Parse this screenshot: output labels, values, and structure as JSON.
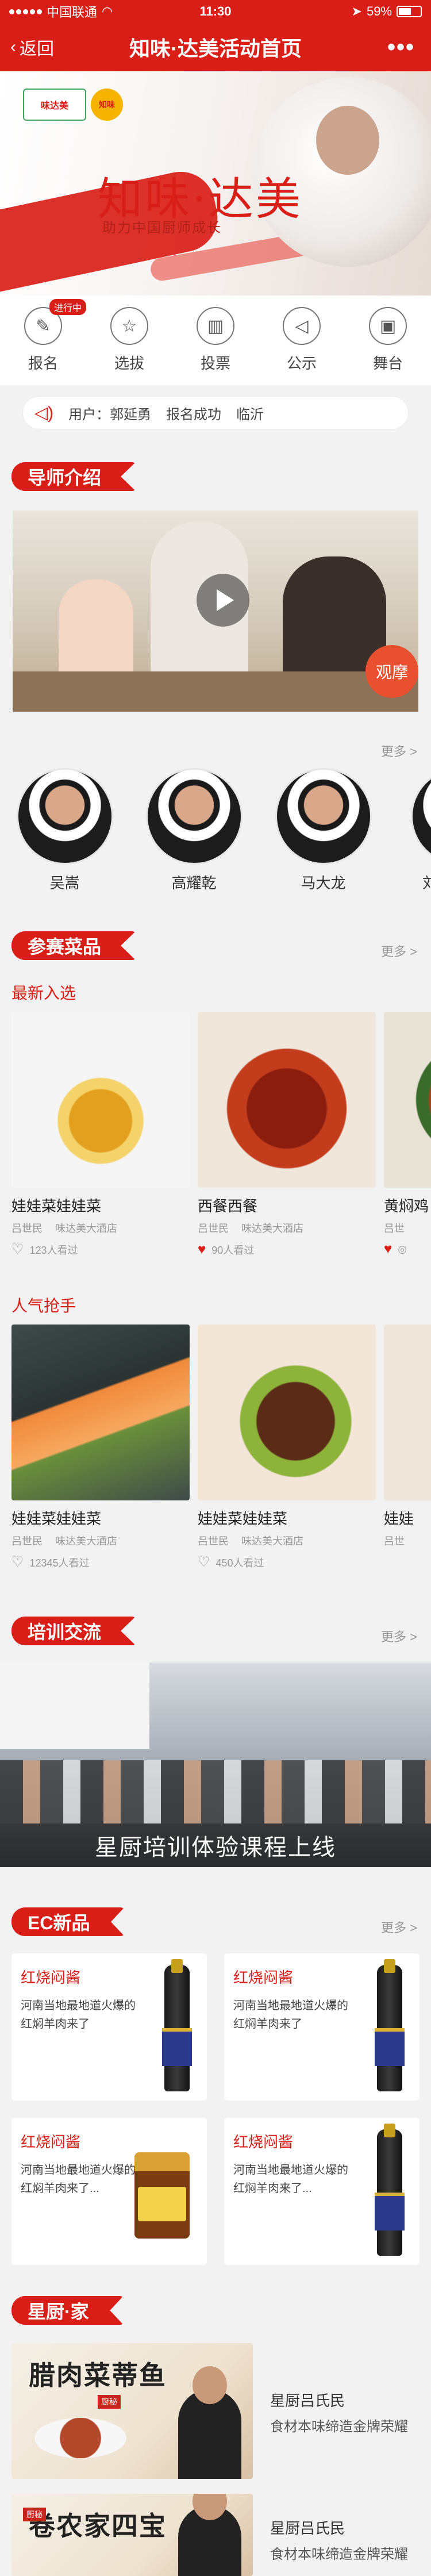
{
  "status_bar": {
    "carrier": "中国联通",
    "time": "11:30",
    "battery": "59%",
    "battery_level": 0.59
  },
  "nav": {
    "back_label": "返回",
    "title": "知味·达美活动首页",
    "more_label": "•••"
  },
  "hero": {
    "brand": "知味·达美",
    "tagline": "助力中国厨师成长",
    "logo_left": "味达美",
    "logo_right": "知味"
  },
  "quick_menu": [
    {
      "label": "报名",
      "icon": "edit-icon",
      "badge": "进行中"
    },
    {
      "label": "选拔",
      "icon": "star-icon"
    },
    {
      "label": "投票",
      "icon": "bar-chart-icon"
    },
    {
      "label": "公示",
      "icon": "megaphone-icon"
    },
    {
      "label": "舞台",
      "icon": "stage-icon"
    }
  ],
  "notice": {
    "user_prefix": "用户：",
    "user_name": "郭延勇",
    "action": "报名成功",
    "city": "临沂"
  },
  "mentor_section": {
    "title": "导师介绍",
    "more": "更多 >",
    "watch_label": "观摩"
  },
  "mentors": [
    {
      "name": "吴嵩"
    },
    {
      "name": "高耀乾"
    },
    {
      "name": "马大龙"
    },
    {
      "name": "刘"
    }
  ],
  "dish_section": {
    "title": "参赛菜品",
    "more": "更多 >"
  },
  "newest": {
    "title": "最新入选",
    "items": [
      {
        "name": "娃娃菜娃娃菜",
        "author": "吕世民",
        "hotel": "味达美大酒店",
        "views": "123人看过",
        "liked": false
      },
      {
        "name": "西餐西餐",
        "author": "吕世民",
        "hotel": "味达美大酒店",
        "views": "90人看过",
        "liked": true
      },
      {
        "name": "黄焖鸡",
        "author": "吕世",
        "hotel": "",
        "views": "",
        "liked": true
      }
    ]
  },
  "popular": {
    "title": "人气抢手",
    "items": [
      {
        "name": "娃娃菜娃娃菜",
        "author": "吕世民",
        "hotel": "味达美大酒店",
        "views": "12345人看过",
        "liked": false
      },
      {
        "name": "娃娃菜娃娃菜",
        "author": "吕世民",
        "hotel": "味达美大酒店",
        "views": "450人看过",
        "liked": false
      },
      {
        "name": "娃娃",
        "author": "吕世",
        "hotel": "",
        "views": "",
        "liked": false
      }
    ]
  },
  "training": {
    "title": "培训交流",
    "more": "更多 >",
    "caption": "星厨培训体验课程上线"
  },
  "ec": {
    "title": "EC新品",
    "more": "更多 >",
    "items": [
      {
        "title": "红烧闷酱",
        "desc": "河南当地最地道火爆的红焖羊肉来了",
        "product": "bottle"
      },
      {
        "title": "红烧闷酱",
        "desc": "河南当地最地道火爆的红焖羊肉来了",
        "product": "bottle"
      },
      {
        "title": "红烧闷酱",
        "desc": "河南当地最地道火爆的红焖羊肉来了...",
        "product": "jar"
      },
      {
        "title": "红烧闷酱",
        "desc": "河南当地最地道火爆的红焖羊肉来了...",
        "product": "bottle"
      }
    ]
  },
  "chef_home": {
    "title": "星厨·家",
    "items": [
      {
        "image_text": "腊肉菜蒂鱼",
        "stamp": "厨秘",
        "name": "星厨吕氏民",
        "desc": "食材本味缔造金牌荣耀"
      },
      {
        "image_text": "卷农家四宝",
        "stamp": "厨秘",
        "name": "星厨吕氏民",
        "desc": "食材本味缔造金牌荣耀"
      }
    ]
  },
  "colors": {
    "brand_red": "#d91e18",
    "muted": "#999999"
  }
}
